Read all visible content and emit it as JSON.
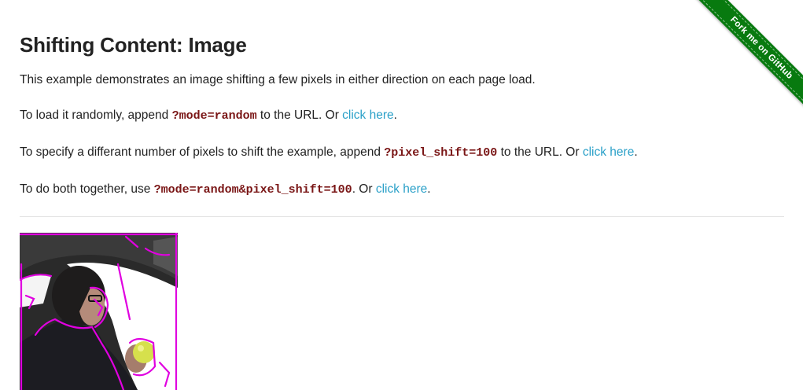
{
  "ribbon": {
    "label": "Fork me on GitHub",
    "color": "#087a0f"
  },
  "page": {
    "title": "Shifting Content: Image",
    "intro": "This example demonstrates an image shifting a few pixels in either direction on each page load.",
    "random": {
      "before": "To load it randomly, append ",
      "param": "?mode=random",
      "middle": " to the URL. Or ",
      "link": "click here",
      "after": "."
    },
    "shift": {
      "before": "To specify a differant number of pixels to shift the example, append ",
      "param": "?pixel_shift=100",
      "middle": " to the URL. Or ",
      "link": "click here",
      "after": "."
    },
    "both": {
      "before": "To do both together, use ",
      "param": "?mode=random&pixel_shift=100",
      "middle": ". Or ",
      "link": "click here",
      "after": "."
    }
  },
  "colors": {
    "param": "#7a1616",
    "link": "#2aa0c8",
    "outline": "#e000e0"
  }
}
